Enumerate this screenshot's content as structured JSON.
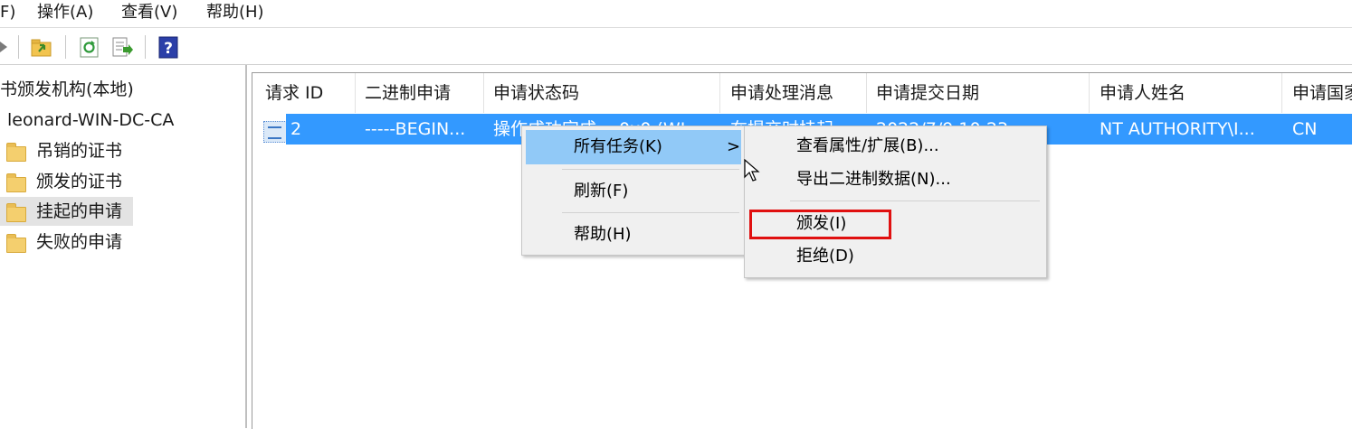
{
  "menubar": {
    "items": [
      "F)",
      "操作(A)",
      "查看(V)",
      "帮助(H)"
    ]
  },
  "toolbar": {
    "buttons": [
      "forward-arrow-icon",
      "up-folder-icon",
      "refresh-icon",
      "export-list-icon",
      "help-icon"
    ]
  },
  "tree": {
    "root_label": "书颁发机构(本地)",
    "ca_label": "leonard-WIN-DC-CA",
    "items": [
      {
        "label": "吊销的证书",
        "selected": false
      },
      {
        "label": "颁发的证书",
        "selected": false
      },
      {
        "label": "挂起的申请",
        "selected": true
      },
      {
        "label": "失败的申请",
        "selected": false
      }
    ]
  },
  "list": {
    "columns": [
      "请求 ID",
      "二进制申请",
      "申请状态码",
      "申请处理消息",
      "申请提交日期",
      "申请人姓名",
      "申请国家"
    ],
    "rows": [
      {
        "request_id": "2",
        "binary": "-----BEGIN...",
        "status_code": "操作成功完成。 0x0 (WI...",
        "message": "在提交时挂起",
        "submit_date": "2022/7/9 10:23",
        "requester": "NT AUTHORITY\\I...",
        "country": "CN"
      }
    ]
  },
  "context_menu": {
    "items": [
      {
        "label": "所有任务(K)",
        "submenu_arrow": ">",
        "highlighted": true
      },
      {
        "label": "刷新(F)",
        "highlighted": false
      },
      {
        "label": "帮助(H)",
        "highlighted": false
      }
    ]
  },
  "submenu": {
    "items": [
      {
        "label": "查看属性/扩展(B)..."
      },
      {
        "label": "导出二进制数据(N)..."
      },
      {
        "label": "颁发(I)",
        "annotated": true
      },
      {
        "label": "拒绝(D)"
      }
    ]
  },
  "colors": {
    "selection": "#3399ff",
    "menu_highlight": "#91c9f7",
    "annotation": "#e01010"
  }
}
